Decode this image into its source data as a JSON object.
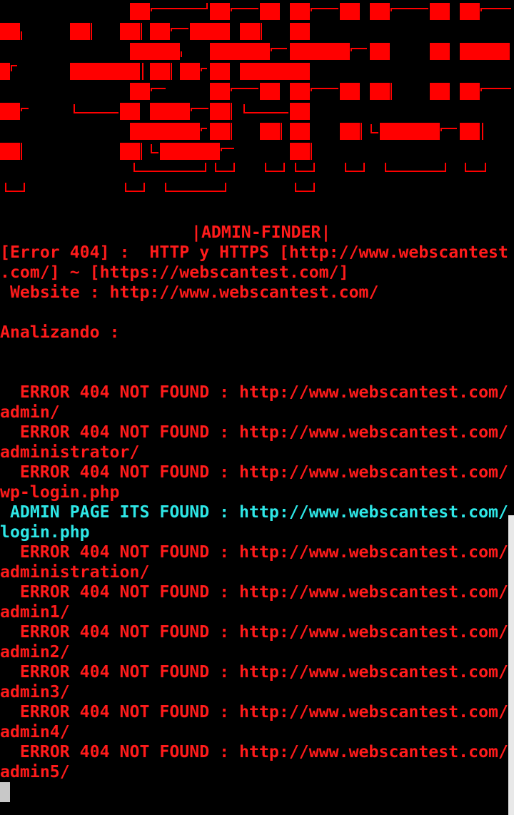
{
  "colors": {
    "background": "#000000",
    "error_text": "#ff1b1b",
    "found_text": "#2ee6e6",
    "banner": "#ff0000"
  },
  "header": {
    "title": "|ADMIN-FINDER|",
    "error_line_1": "[Error 404] :  HTTP y HTTPS [http://www.webscantest",
    "error_line_2": ".com/] ~ [https://webscantest.com/]",
    "website": " Website : http://www.webscantest.com/",
    "analyzing": "Analizando :"
  },
  "results": [
    {
      "status": "  ERROR 404 NOT FOUND : http://www.webscantest.com/",
      "path": "admin/",
      "found": false
    },
    {
      "status": "  ERROR 404 NOT FOUND : http://www.webscantest.com/",
      "path": "administrator/",
      "found": false
    },
    {
      "status": "  ERROR 404 NOT FOUND : http://www.webscantest.com/",
      "path": "wp-login.php",
      "found": false
    },
    {
      "status": " ADMIN PAGE ITS FOUND : http://www.webscantest.com/",
      "path": "login.php",
      "found": true
    },
    {
      "status": "  ERROR 404 NOT FOUND : http://www.webscantest.com/",
      "path": "administration/",
      "found": false
    },
    {
      "status": "  ERROR 404 NOT FOUND : http://www.webscantest.com/",
      "path": "admin1/",
      "found": false
    },
    {
      "status": "  ERROR 404 NOT FOUND : http://www.webscantest.com/",
      "path": "admin2/",
      "found": false
    },
    {
      "status": "  ERROR 404 NOT FOUND : http://www.webscantest.com/",
      "path": "admin3/",
      "found": false
    },
    {
      "status": "  ERROR 404 NOT FOUND : http://www.webscantest.com/",
      "path": "admin4/",
      "found": false
    },
    {
      "status": "  ERROR 404 NOT FOUND : http://www.webscantest.com/",
      "path": "admin5/",
      "found": false
    }
  ]
}
